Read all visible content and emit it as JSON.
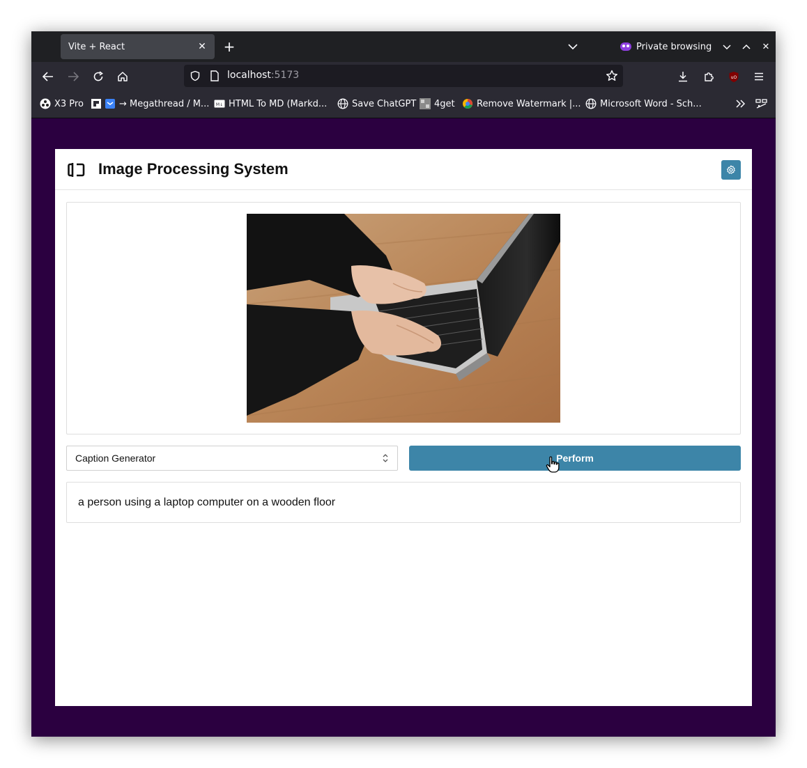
{
  "browser": {
    "tab": {
      "title": "Vite + React"
    },
    "private_label": "Private browsing",
    "url": {
      "host": "localhost",
      "port": ":5173"
    },
    "bookmarks": [
      {
        "label": "X3 Pro",
        "icon": "x3-pro-icon"
      },
      {
        "label": "→ Megathread / M...",
        "icon": "megathread-icon"
      },
      {
        "label": "HTML To MD (Markd...",
        "icon": "markdown-icon"
      },
      {
        "label": "Save ChatGPT",
        "icon": "globe-icon"
      },
      {
        "label": "4get",
        "icon": "4get-icon"
      },
      {
        "label": "Remove Watermark |...",
        "icon": "watermark-icon"
      },
      {
        "label": "Microsoft Word - Sch...",
        "icon": "globe-icon"
      }
    ]
  },
  "app": {
    "title": "Image Processing System",
    "operation": {
      "selected": "Caption Generator"
    },
    "perform_label": "Perform",
    "result_text": "a person using a laptop computer on a wooden floor"
  },
  "colors": {
    "page_bg": "#2b0040",
    "accent": "#3d85a8",
    "browser_toolbar": "#2b2a33",
    "browser_tabstrip": "#1f2023"
  }
}
